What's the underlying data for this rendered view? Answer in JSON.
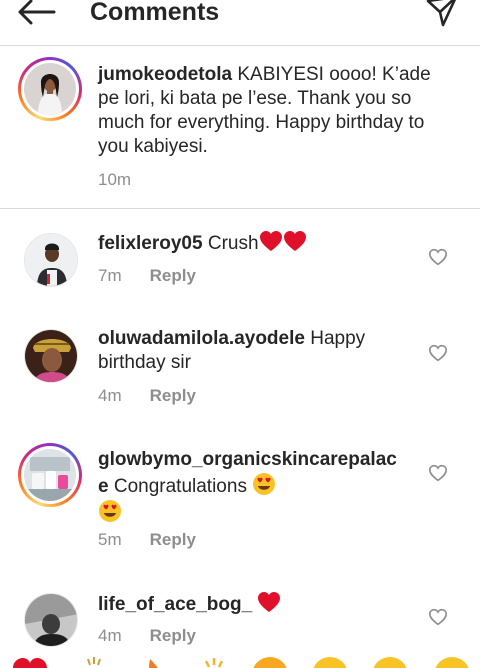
{
  "header": {
    "title": "Comments"
  },
  "caption": {
    "username": "jumokeodetola",
    "text": "KABIYESI oooo! K’ade pe lori, ki bata pe l’ese. Thank you so much for everything. Happy birthday to you kabiyesi.",
    "time": "10m"
  },
  "comments": [
    {
      "username": "felixleroy05",
      "text": "Crush",
      "time": "7m",
      "reply": "Reply"
    },
    {
      "username": "oluwadamilola.ayodele",
      "text": "Happy birthday sir",
      "time": "4m",
      "reply": "Reply"
    },
    {
      "username": "glowbymo_organicskincarepalace",
      "text": "Congratulations",
      "time": "5m",
      "reply": "Reply"
    },
    {
      "username": "life_of_ace_bog_",
      "text": "",
      "time": "4m",
      "reply": "Reply"
    }
  ],
  "colors": {
    "text": "#262626",
    "meta": "#8e8e8e",
    "divider": "#dbdbdb",
    "heart": "#e0102b"
  }
}
